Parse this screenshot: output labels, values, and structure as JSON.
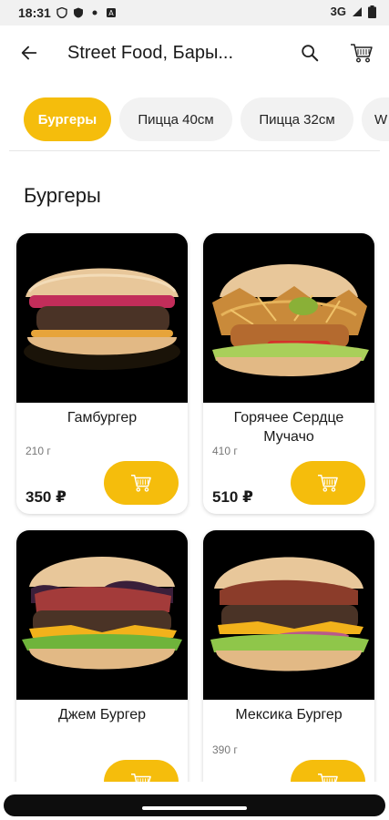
{
  "status_bar": {
    "time": "18:31",
    "network": "3G",
    "icons": [
      "shield-icon",
      "vpn-icon",
      "dot-icon",
      "text-box-icon",
      "signal-icon",
      "battery-icon"
    ]
  },
  "app_bar": {
    "title": "Street Food, Бары...",
    "back_icon": "arrow-left-icon",
    "search_icon": "search-icon",
    "cart_icon": "cart-icon"
  },
  "categories": [
    {
      "label": "Бургеры",
      "active": true
    },
    {
      "label": "Пицца 40см",
      "active": false
    },
    {
      "label": "Пицца 32см",
      "active": false
    },
    {
      "label": "W",
      "active": false
    }
  ],
  "section_title": "Бургеры",
  "products": [
    {
      "name": "Гамбургер",
      "weight": "210 г",
      "price": "350 ₽",
      "image_icon": "hamburger-image"
    },
    {
      "name": "Горячее Сердце Мучачо",
      "weight": "410 г",
      "price": "510 ₽",
      "image_icon": "crispy-burger-image"
    },
    {
      "name": "Джем Бургер",
      "weight": "",
      "price": "",
      "image_icon": "jam-burger-image"
    },
    {
      "name": "Мексика Бургер",
      "weight": "390 г",
      "price": "",
      "image_icon": "mexico-burger-image"
    }
  ],
  "colors": {
    "accent": "#f5bd0c",
    "chip_bg": "#f2f2f2",
    "card_image_bg": "#000000"
  }
}
